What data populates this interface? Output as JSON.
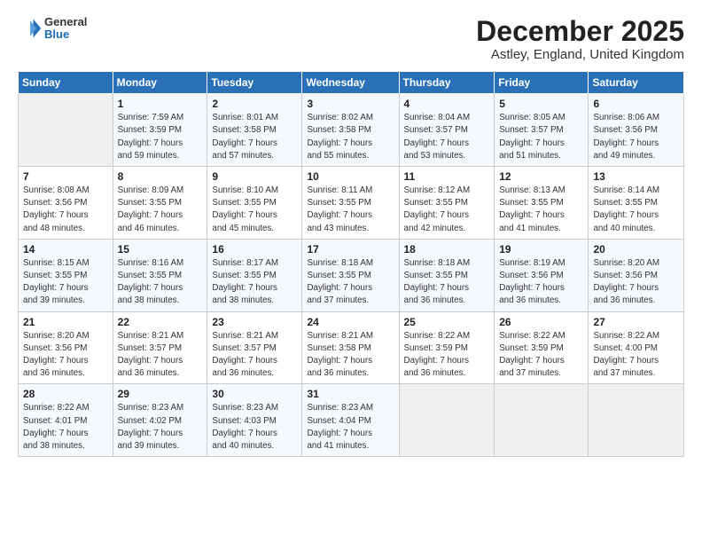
{
  "logo": {
    "general": "General",
    "blue": "Blue"
  },
  "header": {
    "title": "December 2025",
    "location": "Astley, England, United Kingdom"
  },
  "weekdays": [
    "Sunday",
    "Monday",
    "Tuesday",
    "Wednesday",
    "Thursday",
    "Friday",
    "Saturday"
  ],
  "weeks": [
    [
      {
        "day": "",
        "info": ""
      },
      {
        "day": "1",
        "info": "Sunrise: 7:59 AM\nSunset: 3:59 PM\nDaylight: 7 hours\nand 59 minutes."
      },
      {
        "day": "2",
        "info": "Sunrise: 8:01 AM\nSunset: 3:58 PM\nDaylight: 7 hours\nand 57 minutes."
      },
      {
        "day": "3",
        "info": "Sunrise: 8:02 AM\nSunset: 3:58 PM\nDaylight: 7 hours\nand 55 minutes."
      },
      {
        "day": "4",
        "info": "Sunrise: 8:04 AM\nSunset: 3:57 PM\nDaylight: 7 hours\nand 53 minutes."
      },
      {
        "day": "5",
        "info": "Sunrise: 8:05 AM\nSunset: 3:57 PM\nDaylight: 7 hours\nand 51 minutes."
      },
      {
        "day": "6",
        "info": "Sunrise: 8:06 AM\nSunset: 3:56 PM\nDaylight: 7 hours\nand 49 minutes."
      }
    ],
    [
      {
        "day": "7",
        "info": "Sunrise: 8:08 AM\nSunset: 3:56 PM\nDaylight: 7 hours\nand 48 minutes."
      },
      {
        "day": "8",
        "info": "Sunrise: 8:09 AM\nSunset: 3:55 PM\nDaylight: 7 hours\nand 46 minutes."
      },
      {
        "day": "9",
        "info": "Sunrise: 8:10 AM\nSunset: 3:55 PM\nDaylight: 7 hours\nand 45 minutes."
      },
      {
        "day": "10",
        "info": "Sunrise: 8:11 AM\nSunset: 3:55 PM\nDaylight: 7 hours\nand 43 minutes."
      },
      {
        "day": "11",
        "info": "Sunrise: 8:12 AM\nSunset: 3:55 PM\nDaylight: 7 hours\nand 42 minutes."
      },
      {
        "day": "12",
        "info": "Sunrise: 8:13 AM\nSunset: 3:55 PM\nDaylight: 7 hours\nand 41 minutes."
      },
      {
        "day": "13",
        "info": "Sunrise: 8:14 AM\nSunset: 3:55 PM\nDaylight: 7 hours\nand 40 minutes."
      }
    ],
    [
      {
        "day": "14",
        "info": "Sunrise: 8:15 AM\nSunset: 3:55 PM\nDaylight: 7 hours\nand 39 minutes."
      },
      {
        "day": "15",
        "info": "Sunrise: 8:16 AM\nSunset: 3:55 PM\nDaylight: 7 hours\nand 38 minutes."
      },
      {
        "day": "16",
        "info": "Sunrise: 8:17 AM\nSunset: 3:55 PM\nDaylight: 7 hours\nand 38 minutes."
      },
      {
        "day": "17",
        "info": "Sunrise: 8:18 AM\nSunset: 3:55 PM\nDaylight: 7 hours\nand 37 minutes."
      },
      {
        "day": "18",
        "info": "Sunrise: 8:18 AM\nSunset: 3:55 PM\nDaylight: 7 hours\nand 36 minutes."
      },
      {
        "day": "19",
        "info": "Sunrise: 8:19 AM\nSunset: 3:56 PM\nDaylight: 7 hours\nand 36 minutes."
      },
      {
        "day": "20",
        "info": "Sunrise: 8:20 AM\nSunset: 3:56 PM\nDaylight: 7 hours\nand 36 minutes."
      }
    ],
    [
      {
        "day": "21",
        "info": "Sunrise: 8:20 AM\nSunset: 3:56 PM\nDaylight: 7 hours\nand 36 minutes."
      },
      {
        "day": "22",
        "info": "Sunrise: 8:21 AM\nSunset: 3:57 PM\nDaylight: 7 hours\nand 36 minutes."
      },
      {
        "day": "23",
        "info": "Sunrise: 8:21 AM\nSunset: 3:57 PM\nDaylight: 7 hours\nand 36 minutes."
      },
      {
        "day": "24",
        "info": "Sunrise: 8:21 AM\nSunset: 3:58 PM\nDaylight: 7 hours\nand 36 minutes."
      },
      {
        "day": "25",
        "info": "Sunrise: 8:22 AM\nSunset: 3:59 PM\nDaylight: 7 hours\nand 36 minutes."
      },
      {
        "day": "26",
        "info": "Sunrise: 8:22 AM\nSunset: 3:59 PM\nDaylight: 7 hours\nand 37 minutes."
      },
      {
        "day": "27",
        "info": "Sunrise: 8:22 AM\nSunset: 4:00 PM\nDaylight: 7 hours\nand 37 minutes."
      }
    ],
    [
      {
        "day": "28",
        "info": "Sunrise: 8:22 AM\nSunset: 4:01 PM\nDaylight: 7 hours\nand 38 minutes."
      },
      {
        "day": "29",
        "info": "Sunrise: 8:23 AM\nSunset: 4:02 PM\nDaylight: 7 hours\nand 39 minutes."
      },
      {
        "day": "30",
        "info": "Sunrise: 8:23 AM\nSunset: 4:03 PM\nDaylight: 7 hours\nand 40 minutes."
      },
      {
        "day": "31",
        "info": "Sunrise: 8:23 AM\nSunset: 4:04 PM\nDaylight: 7 hours\nand 41 minutes."
      },
      {
        "day": "",
        "info": ""
      },
      {
        "day": "",
        "info": ""
      },
      {
        "day": "",
        "info": ""
      }
    ]
  ]
}
